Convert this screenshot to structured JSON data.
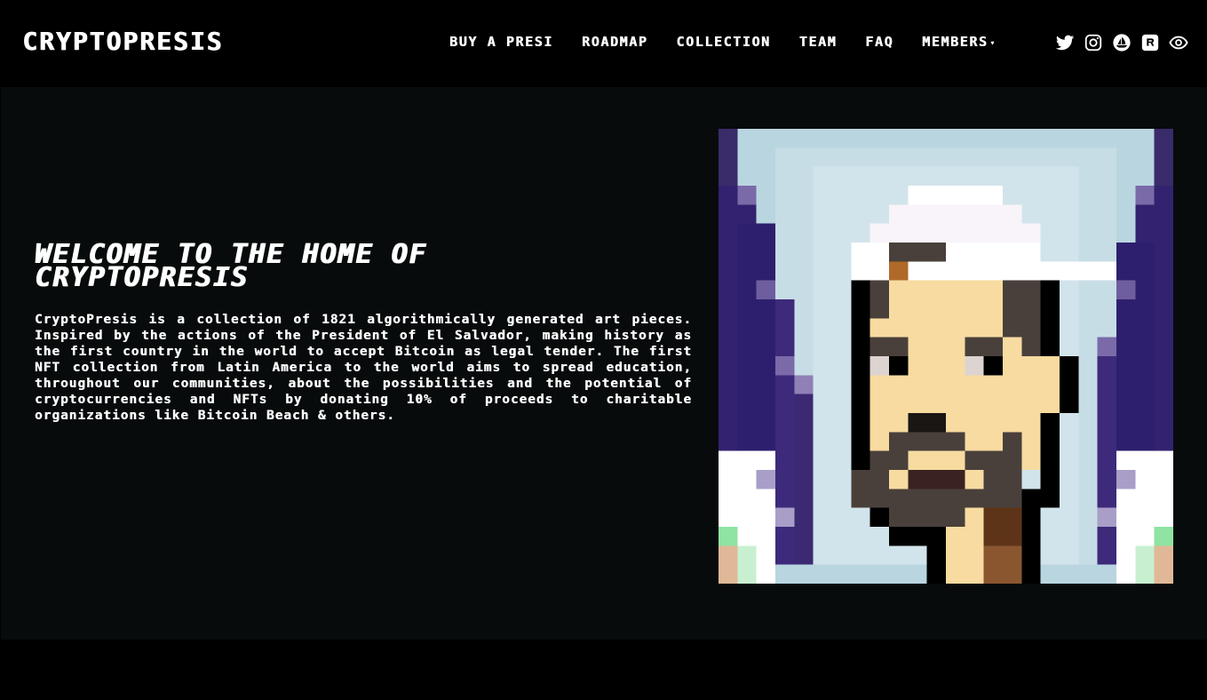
{
  "brand": {
    "name": "CRYPTOPRESIS"
  },
  "nav": {
    "items": [
      {
        "label": "BUY A PRESI"
      },
      {
        "label": "ROADMAP"
      },
      {
        "label": "COLLECTION"
      },
      {
        "label": "TEAM"
      },
      {
        "label": "FAQ"
      },
      {
        "label": "MEMBERS"
      }
    ]
  },
  "socials": [
    "twitter-icon",
    "instagram-icon",
    "opensea-icon",
    "rarible-icon",
    "eye-icon"
  ],
  "hero": {
    "title": "WELCOME TO THE HOME OF CRYPTOPRESIS",
    "description": "CryptoPresis is a collection of 1821 algorithmically generated art pieces. Inspired by the actions of the President of El Salvador, making history as the first country in the world to accept Bitcoin as legal tender. The first NFT collection from Latin America to the world aims to spread education, throughout our communities, about the possibilities and the potential of cryptocurrencies and NFTs by donating 10% of proceeds to charitable organizations like Bitcoin Beach & others."
  },
  "colors": {
    "page_bg": "#000000",
    "hero_bg": "#070b0b",
    "text": "#ffffff"
  }
}
